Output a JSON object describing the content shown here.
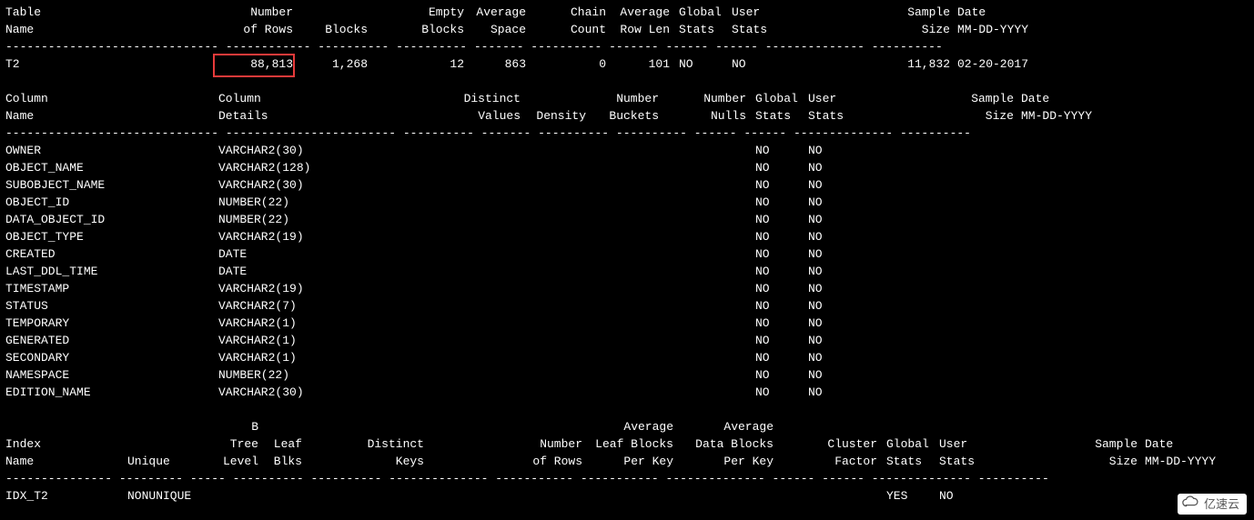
{
  "table_header": {
    "c0a": "Table",
    "c0b": "Name",
    "c1a": "Number",
    "c1b": "of Rows",
    "c2a": "",
    "c2b": "Blocks",
    "c3a": "Empty",
    "c3b": "Blocks",
    "c4a": "Average",
    "c4b": "Space",
    "c5a": "Chain",
    "c5b": "Count",
    "c6a": "Average",
    "c6b": "Row Len",
    "c7a": "Global",
    "c7b": "Stats",
    "c8a": "User",
    "c8b": "Stats",
    "c9a": "Sample",
    "c9b": "Size",
    "c10a": "Date",
    "c10b": "MM-DD-YYYY"
  },
  "table_row": {
    "name": "T2",
    "rows": "88,813",
    "blocks": "1,268",
    "empty": "12",
    "avg_space": "863",
    "chain": "0",
    "rowlen": "101",
    "gstats": "NO",
    "ustats": "NO",
    "sample": "11,832",
    "date": "02-20-2017"
  },
  "col_header": {
    "c0a": "Column",
    "c0b": "Name",
    "c1a": "Column",
    "c1b": "Details",
    "c2a": "Distinct",
    "c2b": "Values",
    "c3a": "",
    "c3b": "Density",
    "c4a": "Number",
    "c4b": "Buckets",
    "c5a": "Number",
    "c5b": "Nulls",
    "c6a": "Global",
    "c6b": "Stats",
    "c7a": "User",
    "c7b": "Stats",
    "c8a": "Sample",
    "c8b": "Size",
    "c9a": "Date",
    "c9b": "MM-DD-YYYY"
  },
  "columns": [
    {
      "name": "OWNER",
      "details": "VARCHAR2(30)",
      "g": "NO",
      "u": "NO"
    },
    {
      "name": "OBJECT_NAME",
      "details": "VARCHAR2(128)",
      "g": "NO",
      "u": "NO"
    },
    {
      "name": "SUBOBJECT_NAME",
      "details": "VARCHAR2(30)",
      "g": "NO",
      "u": "NO"
    },
    {
      "name": "OBJECT_ID",
      "details": "NUMBER(22)",
      "g": "NO",
      "u": "NO"
    },
    {
      "name": "DATA_OBJECT_ID",
      "details": "NUMBER(22)",
      "g": "NO",
      "u": "NO"
    },
    {
      "name": "OBJECT_TYPE",
      "details": "VARCHAR2(19)",
      "g": "NO",
      "u": "NO"
    },
    {
      "name": "CREATED",
      "details": "DATE",
      "g": "NO",
      "u": "NO"
    },
    {
      "name": "LAST_DDL_TIME",
      "details": "DATE",
      "g": "NO",
      "u": "NO"
    },
    {
      "name": "TIMESTAMP",
      "details": "VARCHAR2(19)",
      "g": "NO",
      "u": "NO"
    },
    {
      "name": "STATUS",
      "details": "VARCHAR2(7)",
      "g": "NO",
      "u": "NO"
    },
    {
      "name": "TEMPORARY",
      "details": "VARCHAR2(1)",
      "g": "NO",
      "u": "NO"
    },
    {
      "name": "GENERATED",
      "details": "VARCHAR2(1)",
      "g": "NO",
      "u": "NO"
    },
    {
      "name": "SECONDARY",
      "details": "VARCHAR2(1)",
      "g": "NO",
      "u": "NO"
    },
    {
      "name": "NAMESPACE",
      "details": "NUMBER(22)",
      "g": "NO",
      "u": "NO"
    },
    {
      "name": "EDITION_NAME",
      "details": "VARCHAR2(30)",
      "g": "NO",
      "u": "NO"
    }
  ],
  "idx_header": {
    "c0a": "",
    "c0b": "Index",
    "c0c": "Name",
    "c1a": "",
    "c1b": "",
    "c1c": "Unique",
    "c2a": "B",
    "c2b": "Tree",
    "c2c": "Level",
    "c3a": "",
    "c3b": "Leaf",
    "c3c": "Blks",
    "c4a": "",
    "c4b": "Distinct",
    "c4c": "Keys",
    "c5a": "",
    "c5b": "Number",
    "c5c": "of Rows",
    "c6a": "Average",
    "c6b": "Leaf Blocks",
    "c6c": "Per Key",
    "c7a": "Average",
    "c7b": "Data Blocks",
    "c7c": "Per Key",
    "c8a": "",
    "c8b": "Cluster",
    "c8c": "Factor",
    "c9a": "",
    "c9b": "Global",
    "c9c": "Stats",
    "c10a": "",
    "c10b": "User",
    "c10c": "Stats",
    "c11a": "",
    "c11b": "Sample",
    "c11c": "Size",
    "c12a": "",
    "c12b": "Date",
    "c12c": "MM-DD-YYYY"
  },
  "idx_row": {
    "name": "IDX_T2",
    "unique": "NONUNIQUE",
    "g": "YES",
    "u": "NO"
  },
  "watermark": "亿速云"
}
